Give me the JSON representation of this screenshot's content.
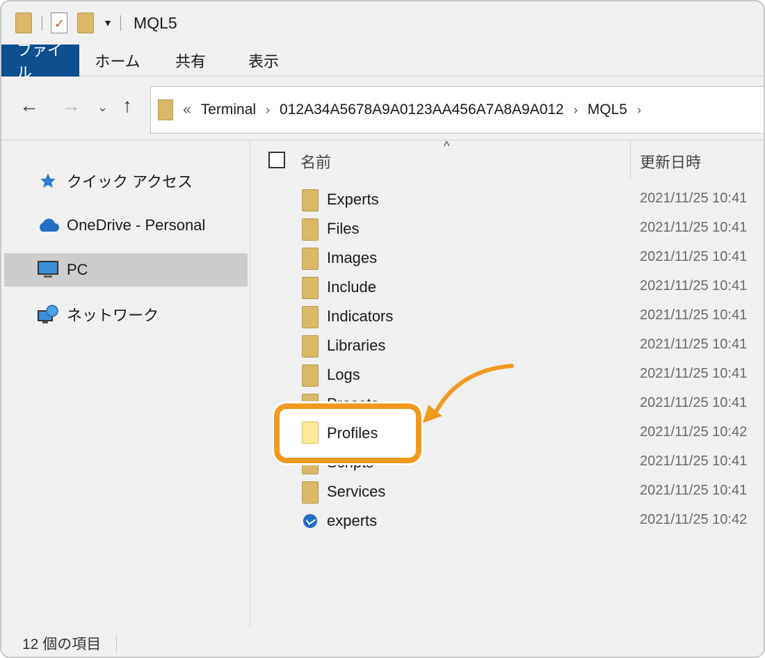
{
  "window": {
    "title": "MQL5",
    "quick_access": {
      "caret": "▾"
    }
  },
  "ribbon": {
    "tabs": [
      {
        "label": "ファイル",
        "active": true
      },
      {
        "label": "ホーム"
      },
      {
        "label": "共有"
      },
      {
        "label": "表示"
      }
    ]
  },
  "nav": {
    "back": "←",
    "forward": "→",
    "recent": "⌄",
    "up": "↑",
    "address": {
      "overflow": "«",
      "crumbs": [
        "Terminal",
        "012A34A5678A9A0123AA456A7A8A9A012",
        "MQL5"
      ],
      "separator": "›"
    }
  },
  "sidebar": {
    "items": [
      {
        "label": "クイック アクセス",
        "icon": "star-icon"
      },
      {
        "label": "OneDrive - Personal",
        "icon": "cloud-icon"
      },
      {
        "label": "PC",
        "icon": "monitor-icon",
        "selected": true
      },
      {
        "label": "ネットワーク",
        "icon": "network-icon"
      }
    ]
  },
  "list": {
    "header": {
      "name": "名前",
      "date": "更新日時",
      "sort_indicator": "^"
    },
    "rows": [
      {
        "name": "Experts",
        "date": "2021/11/25 10:41",
        "type": "folder"
      },
      {
        "name": "Files",
        "date": "2021/11/25 10:41",
        "type": "folder"
      },
      {
        "name": "Images",
        "date": "2021/11/25 10:41",
        "type": "folder"
      },
      {
        "name": "Include",
        "date": "2021/11/25 10:41",
        "type": "folder"
      },
      {
        "name": "Indicators",
        "date": "2021/11/25 10:41",
        "type": "folder"
      },
      {
        "name": "Libraries",
        "date": "2021/11/25 10:41",
        "type": "folder"
      },
      {
        "name": "Logs",
        "date": "2021/11/25 10:41",
        "type": "folder"
      },
      {
        "name": "Presets",
        "date": "2021/11/25 10:41",
        "type": "folder"
      },
      {
        "name": "Profiles",
        "date": "2021/11/25 10:42",
        "type": "folder",
        "highlighted": true
      },
      {
        "name": "Scripts",
        "date": "2021/11/25 10:41",
        "type": "folder"
      },
      {
        "name": "Services",
        "date": "2021/11/25 10:41",
        "type": "folder"
      },
      {
        "name": "experts",
        "date": "2021/11/25 10:42",
        "type": "dat"
      }
    ]
  },
  "status": {
    "item_count": "12 個の項目"
  },
  "colors": {
    "accent": "#0d4f8f",
    "highlight": "#f29a20",
    "folder": "#d9b86a"
  }
}
